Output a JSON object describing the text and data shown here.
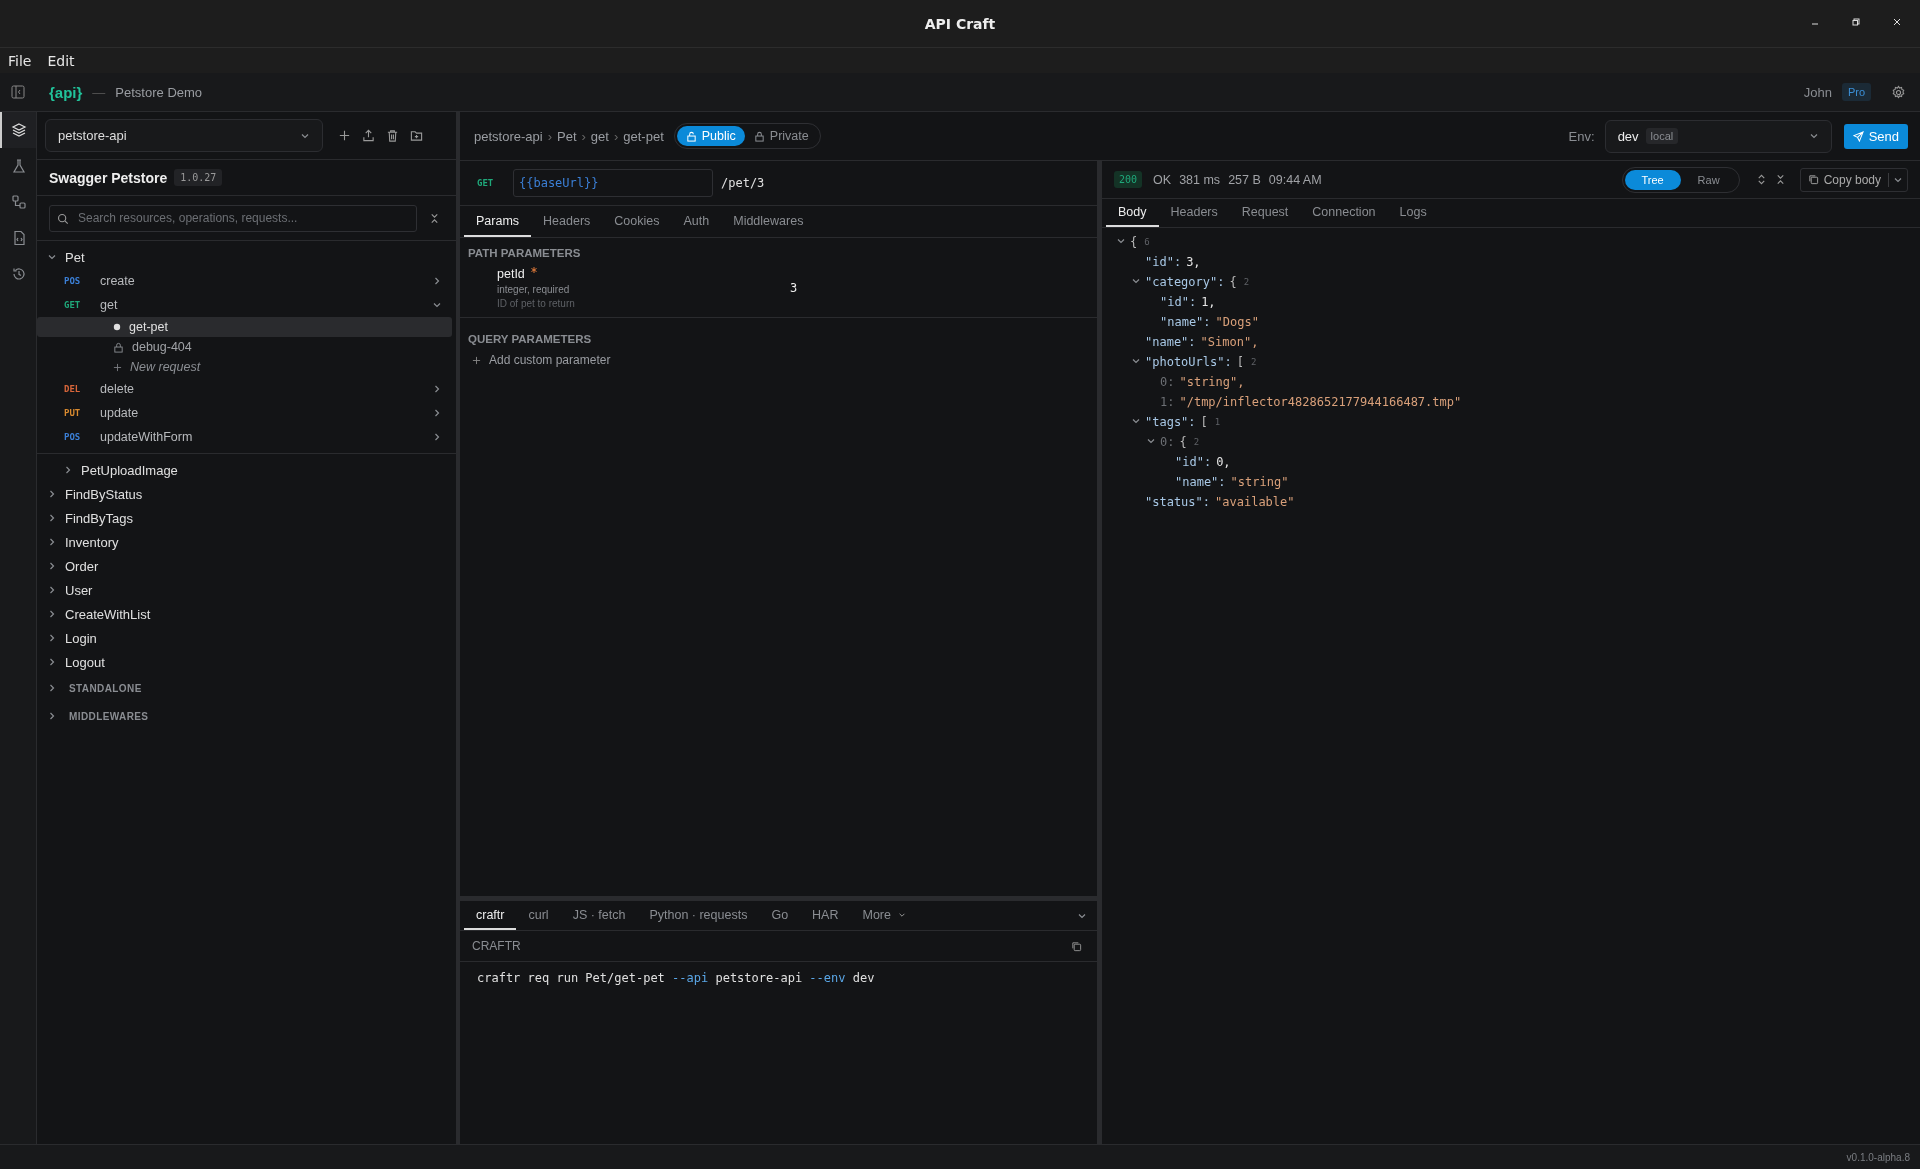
{
  "window": {
    "title": "API Craft"
  },
  "menu": [
    "File",
    "Edit"
  ],
  "header": {
    "logo": "{api}",
    "separator": "—",
    "project": "Petstore Demo",
    "user": "John",
    "plan": "Pro"
  },
  "rail": [
    {
      "selected": true
    },
    {
      "selected": false
    },
    {
      "selected": false
    },
    {
      "selected": false
    },
    {
      "selected": false
    }
  ],
  "sidebar": {
    "api_select": "petstore-api",
    "api_title": "Swagger Petstore",
    "version": "1.0.27",
    "search": {
      "placeholder": "Search resources, operations, requests..."
    },
    "tree": [
      {
        "kind": "group",
        "label": "Pet",
        "expanded": true,
        "children": [
          {
            "kind": "operation",
            "method": "POS",
            "label": "create",
            "expanded": false
          },
          {
            "kind": "operation",
            "method": "GET",
            "label": "get",
            "expanded": true,
            "children": [
              {
                "kind": "request",
                "label": "get-pet",
                "selected": true,
                "private": false
              },
              {
                "kind": "request",
                "label": "debug-404",
                "selected": false,
                "private": true
              },
              {
                "kind": "add",
                "label": "New request"
              }
            ]
          },
          {
            "kind": "operation",
            "method": "DEL",
            "label": "delete",
            "expanded": false
          },
          {
            "kind": "operation",
            "method": "PUT",
            "label": "update",
            "expanded": false
          },
          {
            "kind": "operation",
            "method": "POS",
            "label": "updateWithForm",
            "expanded": false
          },
          {
            "kind": "group",
            "label": "PetUploadImage",
            "expanded": false
          }
        ]
      },
      {
        "kind": "group",
        "label": "FindByStatus",
        "expanded": false
      },
      {
        "kind": "group",
        "label": "FindByTags",
        "expanded": false
      },
      {
        "kind": "group",
        "label": "Inventory",
        "expanded": false
      },
      {
        "kind": "group",
        "label": "Order",
        "expanded": false
      },
      {
        "kind": "group",
        "label": "User",
        "expanded": false
      },
      {
        "kind": "group",
        "label": "CreateWithList",
        "expanded": false
      },
      {
        "kind": "group",
        "label": "Login",
        "expanded": false
      },
      {
        "kind": "group",
        "label": "Logout",
        "expanded": false
      },
      {
        "kind": "section",
        "label": "STANDALONE",
        "expanded": false
      },
      {
        "kind": "section",
        "label": "MIDDLEWARES",
        "expanded": false
      }
    ]
  },
  "breadcrumb": [
    {
      "label": "petstore-api"
    },
    {
      "separator": "›",
      "label": "Pet"
    },
    {
      "separator": "›",
      "label": "get"
    },
    {
      "separator": "›",
      "label": "get-pet"
    }
  ],
  "visibility": [
    {
      "label": "Public",
      "selected": true
    },
    {
      "label": "Private",
      "selected": false
    }
  ],
  "env": {
    "label": "Env:",
    "value": "dev",
    "tag": "local"
  },
  "send": "Send",
  "request": {
    "method": "GET",
    "base_url": "{{baseUrl}}",
    "path": "/pet/3",
    "tabs": [
      {
        "label": "Params",
        "selected": true
      },
      {
        "label": "Headers",
        "selected": false
      },
      {
        "label": "Cookies",
        "selected": false
      },
      {
        "label": "Auth",
        "selected": false
      },
      {
        "label": "Middlewares",
        "selected": false
      }
    ],
    "path_title": "PATH PARAMETERS",
    "path_params": [
      {
        "name": "petId",
        "required": true,
        "type": "integer, required",
        "description": "ID of pet to return",
        "value": "3"
      }
    ],
    "query_title": "QUERY PARAMETERS",
    "add_param": "Add custom parameter"
  },
  "code": {
    "tabs": [
      {
        "label": "craftr",
        "selected": true
      },
      {
        "label": "curl",
        "selected": false
      },
      {
        "label": "JS · fetch",
        "selected": false
      },
      {
        "label": "Python · requests",
        "selected": false
      },
      {
        "label": "Go",
        "selected": false
      },
      {
        "label": "HAR",
        "selected": false
      },
      {
        "label": "More",
        "selected": false,
        "menu": true
      }
    ],
    "language": "CRAFTR",
    "command": [
      {
        "text": "craftr req run Pet/get-pet ",
        "kind": "plain"
      },
      {
        "text": "--api",
        "kind": "flag"
      },
      {
        "text": " petstore-api ",
        "kind": "plain"
      },
      {
        "text": "--env",
        "kind": "flag"
      },
      {
        "text": " dev",
        "kind": "plain"
      }
    ]
  },
  "response": {
    "status_code": "200",
    "status_text": "OK",
    "time": "381 ms",
    "size": "257 B",
    "clock": "09:44 AM",
    "views": [
      {
        "label": "Tree",
        "selected": true
      },
      {
        "label": "Raw",
        "selected": false
      }
    ],
    "copy": "Copy body",
    "tabs": [
      {
        "label": "Body",
        "selected": true
      },
      {
        "label": "Headers",
        "selected": false
      },
      {
        "label": "Request",
        "selected": false
      },
      {
        "label": "Connection",
        "selected": false
      },
      {
        "label": "Logs",
        "selected": false
      }
    ],
    "body": [
      {
        "kind": "object",
        "bracket": "{",
        "count": "6",
        "expanded": true,
        "children": [
          {
            "kind": "number",
            "key": "\"id\":",
            "value": "3,"
          },
          {
            "kind": "object",
            "key": "\"category\":",
            "bracket": "{",
            "count": "2",
            "expanded": true,
            "children": [
              {
                "kind": "number",
                "key": "\"id\":",
                "value": "1,"
              },
              {
                "kind": "string",
                "key": "\"name\":",
                "value": "\"Dogs\""
              }
            ]
          },
          {
            "kind": "string",
            "key": "\"name\":",
            "value": "\"Simon\","
          },
          {
            "kind": "array",
            "key": "\"photoUrls\":",
            "bracket": "[",
            "count": "2",
            "expanded": true,
            "children": [
              {
                "kind": "string",
                "index": "0:",
                "value": "\"string\","
              },
              {
                "kind": "string",
                "index": "1:",
                "value": "\"/tmp/inflector4828652177944166487.tmp\""
              }
            ]
          },
          {
            "kind": "array",
            "key": "\"tags\":",
            "bracket": "[",
            "count": "1",
            "expanded": true,
            "children": [
              {
                "kind": "object",
                "index": "0:",
                "bracket": "{",
                "count": "2",
                "expanded": true,
                "children": [
                  {
                    "kind": "number",
                    "key": "\"id\":",
                    "value": "0,"
                  },
                  {
                    "kind": "string",
                    "key": "\"name\":",
                    "value": "\"string\""
                  }
                ]
              }
            ]
          },
          {
            "kind": "string",
            "key": "\"status\":",
            "value": "\"available\""
          }
        ]
      }
    ]
  },
  "status_bar": {
    "version": "v0.1.0-alpha.8"
  }
}
